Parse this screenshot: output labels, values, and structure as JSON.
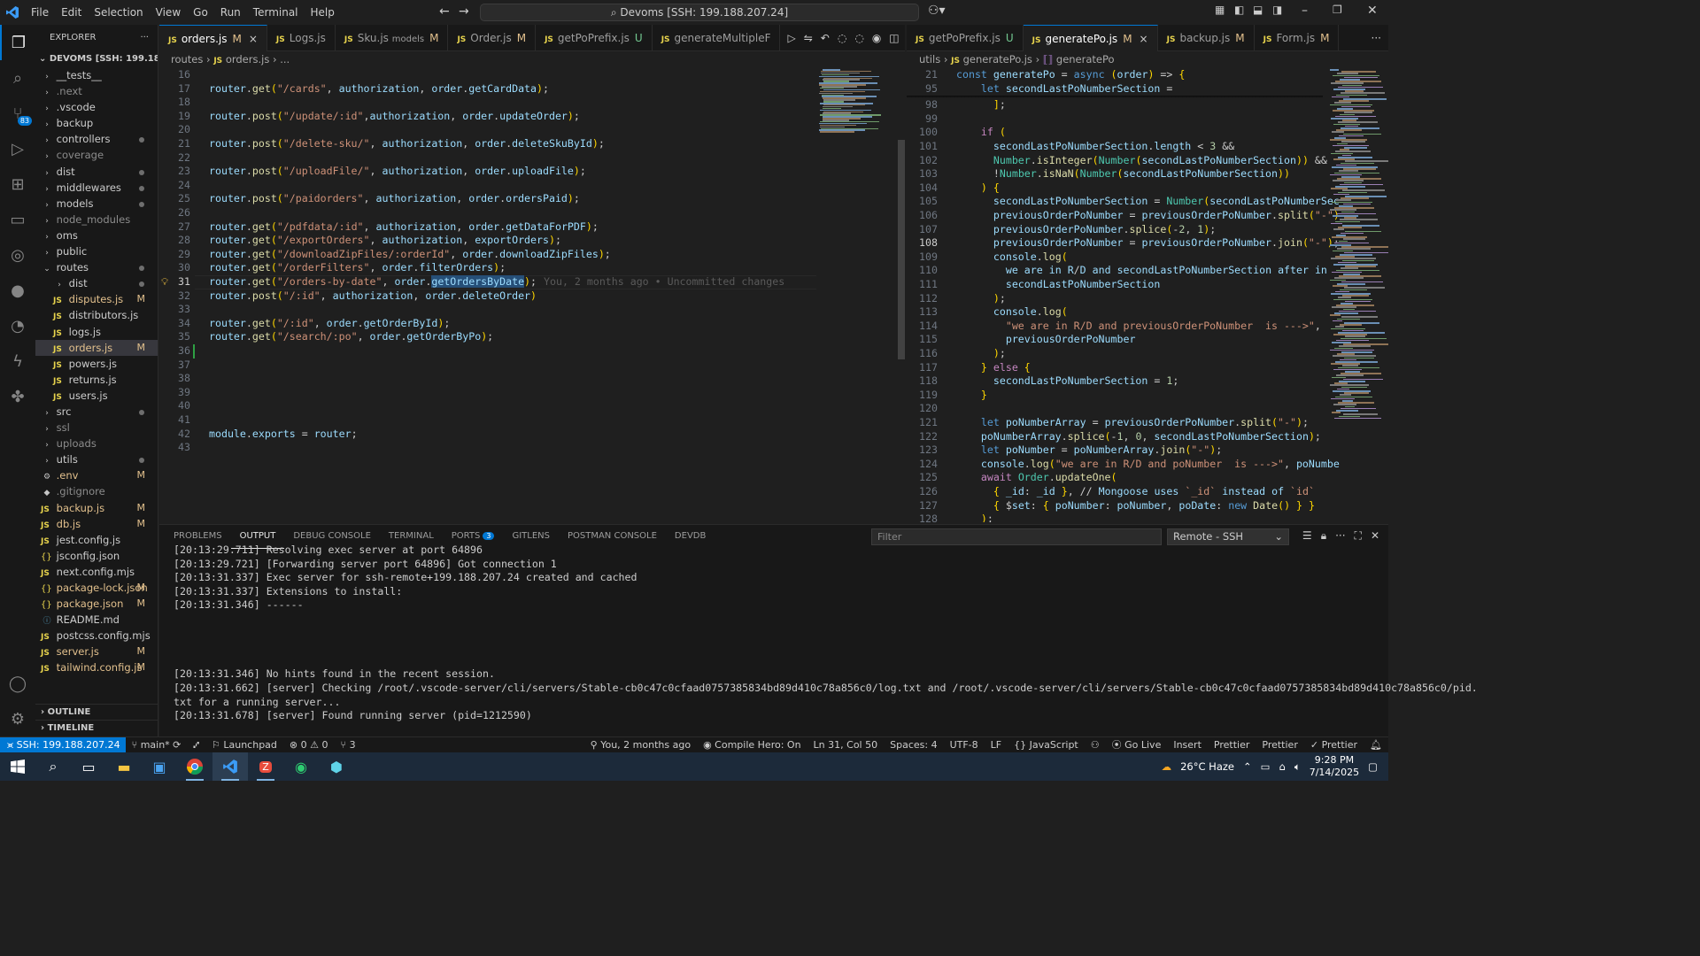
{
  "titlebar": {
    "menus": [
      "File",
      "Edit",
      "Selection",
      "View",
      "Go",
      "Run",
      "Terminal",
      "Help"
    ],
    "search": "Devoms [SSH: 199.188.207.24]"
  },
  "explorer": {
    "title": "EXPLORER",
    "root": "DEVOMS [SSH: 199.188.20...",
    "items": [
      {
        "label": "__tests__",
        "kind": "folder",
        "state": ""
      },
      {
        "label": ".next",
        "kind": "folder",
        "state": ""
      },
      {
        "label": ".vscode",
        "kind": "folder",
        "state": ""
      },
      {
        "label": "backup",
        "kind": "folder",
        "state": ""
      },
      {
        "label": "controllers",
        "kind": "folder",
        "state": "dot"
      },
      {
        "label": "coverage",
        "kind": "folder",
        "state": ""
      },
      {
        "label": "dist",
        "kind": "folder",
        "state": "dot"
      },
      {
        "label": "middlewares",
        "kind": "folder",
        "state": "dot"
      },
      {
        "label": "models",
        "kind": "folder",
        "state": "dot"
      },
      {
        "label": "node_modules",
        "kind": "folder",
        "state": ""
      },
      {
        "label": "oms",
        "kind": "folder",
        "state": ""
      },
      {
        "label": "public",
        "kind": "folder",
        "state": ""
      },
      {
        "label": "routes",
        "kind": "open",
        "state": "dot"
      },
      {
        "label": "dist",
        "kind": "subfolder",
        "state": "dot"
      },
      {
        "label": "disputes.js",
        "kind": "subjs",
        "state": "M"
      },
      {
        "label": "distributors.js",
        "kind": "subjs",
        "state": ""
      },
      {
        "label": "logs.js",
        "kind": "subjs",
        "state": ""
      },
      {
        "label": "orders.js",
        "kind": "subjs",
        "state": "M"
      },
      {
        "label": "powers.js",
        "kind": "subjs",
        "state": ""
      },
      {
        "label": "returns.js",
        "kind": "subjs",
        "state": ""
      },
      {
        "label": "users.js",
        "kind": "subjs",
        "state": ""
      },
      {
        "label": "src",
        "kind": "folder",
        "state": "dot"
      },
      {
        "label": "ssl",
        "kind": "folder",
        "state": ""
      },
      {
        "label": "uploads",
        "kind": "folder",
        "state": ""
      },
      {
        "label": "utils",
        "kind": "folder",
        "state": "dot"
      },
      {
        "label": ".env",
        "kind": "gear",
        "state": "M"
      },
      {
        "label": ".gitignore",
        "kind": "git",
        "state": ""
      },
      {
        "label": "backup.js",
        "kind": "js",
        "state": "M"
      },
      {
        "label": "db.js",
        "kind": "js",
        "state": "M"
      },
      {
        "label": "jest.config.js",
        "kind": "js",
        "state": ""
      },
      {
        "label": "jsconfig.json",
        "kind": "json",
        "state": ""
      },
      {
        "label": "next.config.mjs",
        "kind": "js",
        "state": ""
      },
      {
        "label": "package-lock.json",
        "kind": "json",
        "state": "M"
      },
      {
        "label": "package.json",
        "kind": "json",
        "state": "M"
      },
      {
        "label": "README.md",
        "kind": "info",
        "state": ""
      },
      {
        "label": "postcss.config.mjs",
        "kind": "js",
        "state": ""
      },
      {
        "label": "server.js",
        "kind": "js",
        "state": "M"
      },
      {
        "label": "tailwind.config.js",
        "kind": "js",
        "state": "M"
      }
    ],
    "outline": "OUTLINE",
    "timeline": "TIMELINE"
  },
  "tabs_left": [
    {
      "label": "orders.js",
      "status": "M",
      "active": true,
      "close": "×"
    },
    {
      "label": "Logs.js",
      "status": "",
      "active": false
    },
    {
      "label": "Sku.js",
      "extra": "models",
      "status": "M",
      "active": false
    },
    {
      "label": "Order.js",
      "status": "M",
      "active": false
    },
    {
      "label": "getPoPrefix.js",
      "status": "U",
      "active": false
    },
    {
      "label": "generateMultipleF",
      "status": "",
      "active": false
    }
  ],
  "tabs_right": [
    {
      "label": "getPoPrefix.js",
      "status": "U",
      "active": false
    },
    {
      "label": "generatePo.js",
      "status": "M",
      "active": true,
      "close": "×"
    },
    {
      "label": "backup.js",
      "status": "M",
      "active": false
    },
    {
      "label": "Form.js",
      "status": "M",
      "active": false
    }
  ],
  "breadcrumb_left": [
    "routes",
    "orders.js",
    "..."
  ],
  "breadcrumb_right": [
    "utils",
    "generatePo.js",
    "generatePo"
  ],
  "editor_left": {
    "blame": "You, 2 months ago • Uncommitted changes",
    "lines": [
      {
        "n": "16",
        "t": ""
      },
      {
        "n": "17",
        "t": "router.get(\"/cards\", authorization, order.getCardData);"
      },
      {
        "n": "18",
        "t": ""
      },
      {
        "n": "19",
        "t": "router.post(\"/update/:id\",authorization, order.updateOrder);"
      },
      {
        "n": "20",
        "t": ""
      },
      {
        "n": "21",
        "t": "router.post(\"/delete-sku/\", authorization, order.deleteSkuById);"
      },
      {
        "n": "22",
        "t": ""
      },
      {
        "n": "23",
        "t": "router.post(\"/uploadFile/\", authorization, order.uploadFile);"
      },
      {
        "n": "24",
        "t": ""
      },
      {
        "n": "25",
        "t": "router.post(\"/paidorders\", authorization, order.ordersPaid);"
      },
      {
        "n": "26",
        "t": ""
      },
      {
        "n": "27",
        "t": "router.get(\"/pdfdata/:id\", authorization, order.getDataForPDF);"
      },
      {
        "n": "28",
        "t": "router.get(\"/exportOrders\", authorization, exportOrders);"
      },
      {
        "n": "29",
        "t": "router.get(\"/downloadZipFiles/:orderId\", order.downloadZipFiles);"
      },
      {
        "n": "30",
        "t": "router.get(\"/orderFilters\", order.filterOrders);"
      },
      {
        "n": "31",
        "t": "router.get(\"/orders-by-date\", order.getOrdersByDate);"
      },
      {
        "n": "32",
        "t": "router.post(\"/:id\", authorization, order.deleteOrder)"
      },
      {
        "n": "33",
        "t": ""
      },
      {
        "n": "34",
        "t": "router.get(\"/:id\", order.getOrderById);"
      },
      {
        "n": "35",
        "t": "router.get(\"/search/:po\", order.getOrderByPo);"
      },
      {
        "n": "36",
        "t": ""
      },
      {
        "n": "37",
        "t": ""
      },
      {
        "n": "38",
        "t": ""
      },
      {
        "n": "39",
        "t": ""
      },
      {
        "n": "40",
        "t": ""
      },
      {
        "n": "41",
        "t": ""
      },
      {
        "n": "42",
        "t": "module.exports = router;"
      },
      {
        "n": "43",
        "t": ""
      }
    ]
  },
  "editor_right": {
    "sticky": [
      {
        "n": "21",
        "t": "const generatePo = async (order) => {"
      },
      {
        "n": "95",
        "t": "    let secondLastPoNumberSection ="
      }
    ],
    "lines": [
      {
        "n": "98",
        "t": "      ];"
      },
      {
        "n": "99",
        "t": ""
      },
      {
        "n": "100",
        "t": "    if ("
      },
      {
        "n": "101",
        "t": "      secondLastPoNumberSection.length < 3 &&"
      },
      {
        "n": "102",
        "t": "      Number.isInteger(Number(secondLastPoNumberSection)) &&"
      },
      {
        "n": "103",
        "t": "      !Number.isNaN(Number(secondLastPoNumberSection))"
      },
      {
        "n": "104",
        "t": "    ) {"
      },
      {
        "n": "105",
        "t": "      secondLastPoNumberSection = Number(secondLastPoNumberSec"
      },
      {
        "n": "106",
        "t": "      previousOrderPoNumber = previousOrderPoNumber.split(\"-\")"
      },
      {
        "n": "107",
        "t": "      previousOrderPoNumber.splice(-2, 1);"
      },
      {
        "n": "108",
        "t": "      previousOrderPoNumber = previousOrderPoNumber.join(\"-\");"
      },
      {
        "n": "109",
        "t": "      console.log("
      },
      {
        "n": "110",
        "t": "        \"we are in R/D and secondLastPoNumberSection after in"
      },
      {
        "n": "111",
        "t": "        secondLastPoNumberSection"
      },
      {
        "n": "112",
        "t": "      );"
      },
      {
        "n": "113",
        "t": "      console.log("
      },
      {
        "n": "114",
        "t": "        \"we are in R/D and previousOrderPoNumber  is --->\","
      },
      {
        "n": "115",
        "t": "        previousOrderPoNumber"
      },
      {
        "n": "116",
        "t": "      );"
      },
      {
        "n": "117",
        "t": "    } else {"
      },
      {
        "n": "118",
        "t": "      secondLastPoNumberSection = 1;"
      },
      {
        "n": "119",
        "t": "    }"
      },
      {
        "n": "120",
        "t": ""
      },
      {
        "n": "121",
        "t": "    let poNumberArray = previousOrderPoNumber.split(\"-\");"
      },
      {
        "n": "122",
        "t": "    poNumberArray.splice(-1, 0, secondLastPoNumberSection);"
      },
      {
        "n": "123",
        "t": "    let poNumber = poNumberArray.join(\"-\");"
      },
      {
        "n": "124",
        "t": "    console.log(\"we are in R/D and poNumber  is --->\", poNumbe"
      },
      {
        "n": "125",
        "t": "    await Order.updateOne("
      },
      {
        "n": "126",
        "t": "      { _id: _id }, // Mongoose uses `_id` instead of `id`"
      },
      {
        "n": "127",
        "t": "      { $set: { poNumber: poNumber, poDate: new Date() } }"
      },
      {
        "n": "128",
        "t": "    );"
      }
    ]
  },
  "panel": {
    "tabs": [
      "PROBLEMS",
      "OUTPUT",
      "DEBUG CONSOLE",
      "TERMINAL",
      "PORTS",
      "GITLENS",
      "POSTMAN CONSOLE",
      "DEVDB"
    ],
    "ports_badge": "3",
    "filter_placeholder": "Filter",
    "channel": "Remote - SSH",
    "lines": [
      "[20:13:29.711] Resolving exec server at port 64896",
      "[20:13:29.721] [Forwarding server port 64896] Got connection 1",
      "[20:13:31.337] Exec server for ssh-remote+199.188.207.24 created and cached",
      "[20:13:31.337] Extensions to install:",
      "[20:13:31.346] ------",
      "",
      "",
      "",
      "",
      "[20:13:31.346] No hints found in the recent session.",
      "[20:13:31.662] [server] Checking /root/.vscode-server/cli/servers/Stable-cb0c47c0cfaad0757385834bd89d410c78a856c0/log.txt and /root/.vscode-server/cli/servers/Stable-cb0c47c0cfaad0757385834bd89d410c78a856c0/pid.",
      "txt for a running server...",
      "[20:13:31.678] [server] Found running server (pid=1212590)"
    ]
  },
  "status": {
    "remote": "SSH: 199.188.207.24",
    "branch": "main*",
    "launchpad": "Launchpad",
    "errors": "0",
    "warnings": "0",
    "ports": "3",
    "blame": "You, 2 months ago",
    "compile": "Compile Hero: On",
    "position": "Ln 31, Col 50",
    "spaces": "Spaces: 4",
    "encoding": "UTF-8",
    "eol": "LF",
    "language": "JavaScript",
    "golive": "Go Live",
    "insert": "Insert",
    "prettier1": "Prettier",
    "prettier2": "Prettier",
    "prettier3": "Prettier"
  },
  "taskbar": {
    "weather": "26°C Haze",
    "time": "9:28 PM",
    "date": "7/14/2025"
  },
  "colors": {
    "accent": "#0078d4",
    "modified": "#e2c08d",
    "untracked": "#73c991"
  }
}
